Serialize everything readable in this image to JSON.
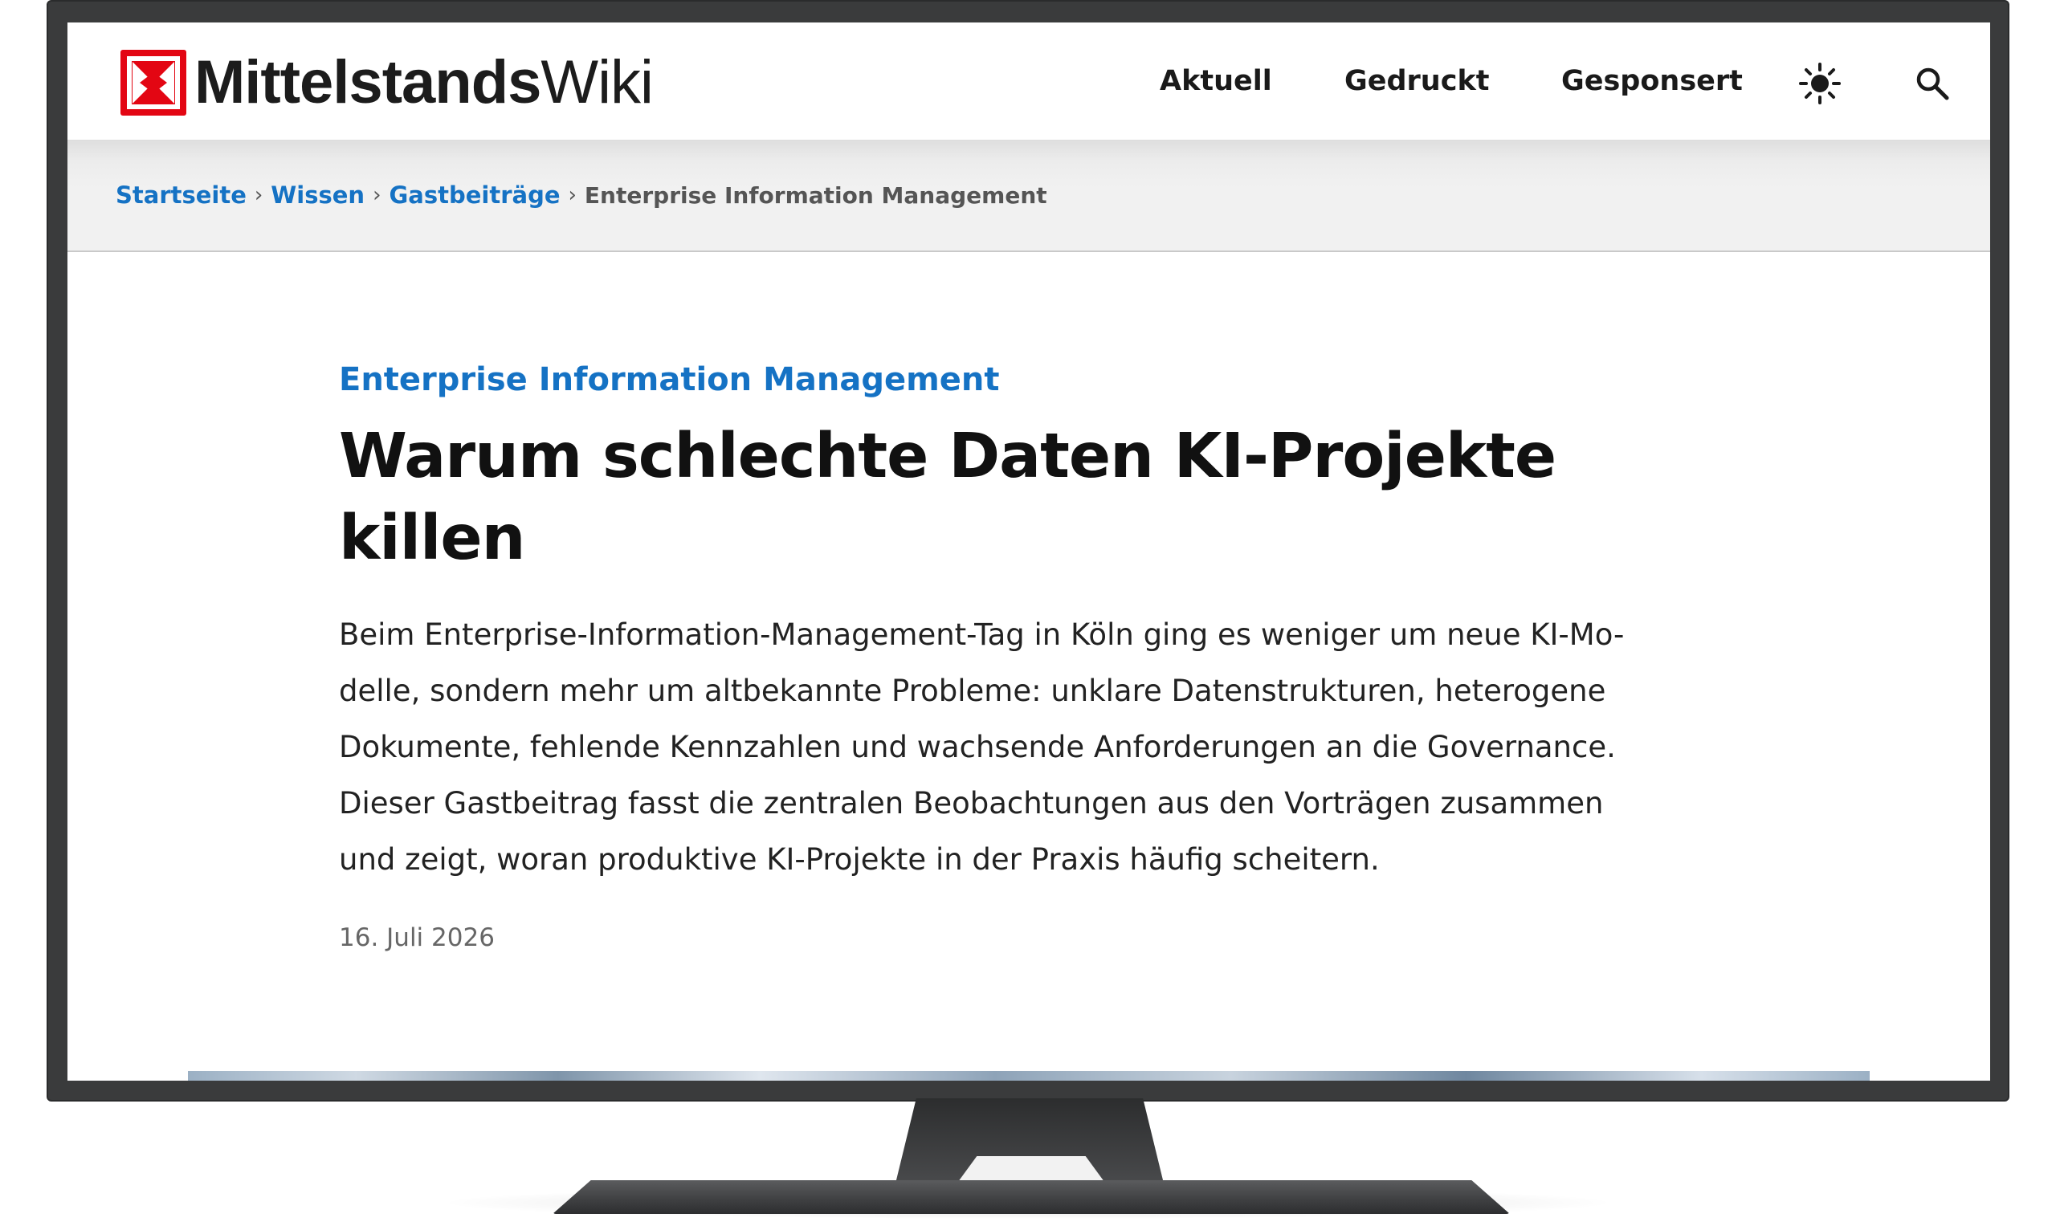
{
  "header": {
    "logo_bold": "Mittelstands",
    "logo_light": "Wiki",
    "brand_color": "#e30613",
    "nav": [
      {
        "label": "Aktuell"
      },
      {
        "label": "Gedruckt"
      },
      {
        "label": "Gesponsert"
      }
    ],
    "icons": {
      "theme": "sun-icon",
      "search": "search-icon"
    }
  },
  "breadcrumb": {
    "items": [
      {
        "label": "Startseite"
      },
      {
        "label": "Wissen"
      },
      {
        "label": "Gastbeiträge"
      }
    ],
    "current": "Enterprise Information Management",
    "separator": "›",
    "link_color": "#1572c4"
  },
  "article": {
    "kicker": "Enterprise Information Management",
    "title": "Warum schlechte Daten KI-Projekte killen",
    "lead": "Beim Enterprise-Information-Management-Tag in Köln ging es weniger um neue KI-Mo-\ndelle, sondern mehr um altbekannte Probleme: unklare Datenstrukturen, heterogene\nDokumente, fehlende Kennzahlen und wachsende Anforderungen an die Governance.\nDieser Gastbeitrag fasst die zentralen Beobachtungen aus den Vorträgen zusammen\nund zeigt, woran produktive KI-Projekte in der Praxis häufig scheitern.",
    "date": "16. Juli 2026"
  }
}
